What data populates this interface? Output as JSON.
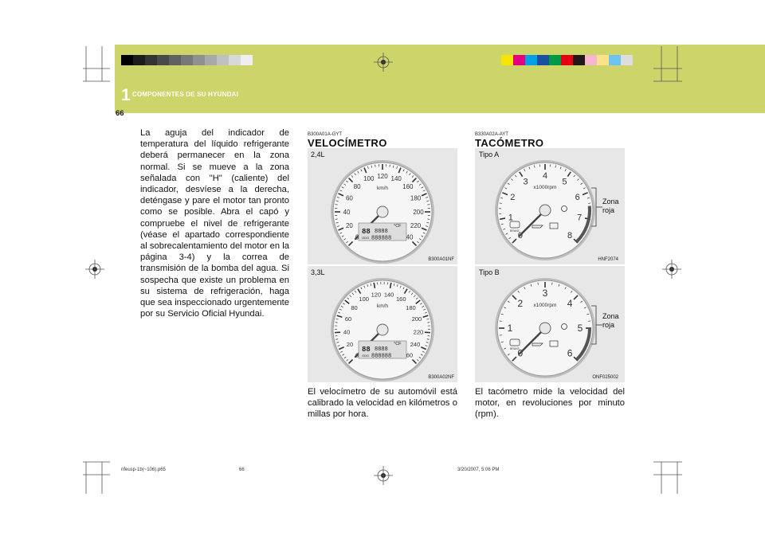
{
  "header": {
    "chapter_number": "1",
    "chapter_title": "COMPONENTES DE SU HYUNDAI",
    "page_number": "66",
    "left_swatches": [
      "#000000",
      "#1c1c1c",
      "#333333",
      "#4a4a4a",
      "#616161",
      "#787878",
      "#909090",
      "#a8a8a8",
      "#c0c0c0",
      "#d8d8d8",
      "#efefef"
    ],
    "right_swatches": [
      "#f5e500",
      "#e4007f",
      "#00a0e9",
      "#1d4fa0",
      "#009944",
      "#e60012",
      "#231815",
      "#f7b5cf",
      "#fce38a",
      "#6ec3ef",
      "#dddddd"
    ]
  },
  "left_column": {
    "paragraph": "La aguja del indicador de temperatura del líquido refrigerante deberá permanecer en la zona normal. Si se mueve a la zona señalada con \"H\" (caliente) del indicador, desvíese a la derecha, deténgase y pare el motor tan pronto como se posible. Abra el capó y compruebe el nivel de refrigerante (véase el apartado correspondiente al sobrecalentamiento del motor en la página 3-4) y la correa de transmisión de la bomba del agua. Si sospecha que existe un problema en su sistema de refrigeración, haga que sea inspeccionado urgentemente por su Servicio Oficial Hyundai."
  },
  "middle_column": {
    "code": "B300A01A-GYT",
    "title": "VELOCÍMETRO",
    "figure1": {
      "label": "2,4L",
      "code": "B300A01NF",
      "unit": "km/h",
      "ticks": [
        "0",
        "20",
        "40",
        "60",
        "80",
        "100",
        "120",
        "140",
        "160",
        "180",
        "200",
        "220",
        "240"
      ],
      "display_small": "88",
      "display_digits": "8888",
      "odo_label": "ODO",
      "odo_digits": "888888",
      "temp_unit": "°CF"
    },
    "figure2": {
      "label": "3,3L",
      "code": "B300A02NF",
      "unit": "km/h",
      "ticks": [
        "0",
        "20",
        "40",
        "60",
        "80",
        "100",
        "120",
        "140",
        "160",
        "180",
        "200",
        "220",
        "240",
        "260"
      ],
      "display_small": "88",
      "display_digits": "8888",
      "odo_label": "ODO",
      "odo_digits": "888888",
      "temp_unit": "°CF"
    },
    "paragraph": "El velocímetro de su automóvil está calibrado la velocidad en kilómetros o millas por hora."
  },
  "right_column": {
    "code": "B330A02A-AYT",
    "title": "TACÓMETRO",
    "figure1": {
      "label": "Tipo A",
      "code": "HNF2074",
      "unit": "x1000rpm",
      "ticks": [
        "0",
        "1",
        "2",
        "3",
        "4",
        "5",
        "6",
        "7",
        "8"
      ],
      "zone_label": "Zona roja",
      "brake_label": "BRAKE"
    },
    "figure2": {
      "label": "Tipo B",
      "code": "ONF025002",
      "unit": "x1000rpm",
      "ticks": [
        "0",
        "1",
        "2",
        "3",
        "4",
        "5",
        "6"
      ],
      "zone_label": "Zona roja",
      "brake_label": "BRAKE"
    },
    "paragraph": "El tacómetro mide la velocidad del motor, en revoluciones por minuto (rpm)."
  },
  "footer": {
    "file": "nfeusp-1b(~106).p65",
    "page": "66",
    "date": "3/20/2007, 5:06 PM"
  }
}
